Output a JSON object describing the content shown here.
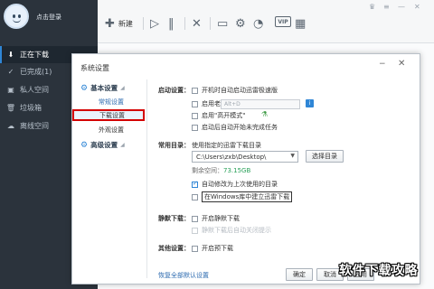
{
  "sidebar": {
    "login_text": "点击登录",
    "items": [
      {
        "label": "正在下载",
        "icon": "download-icon",
        "glyph": "⬇"
      },
      {
        "label": "已完成(1)",
        "icon": "check-circle-icon",
        "glyph": "✓"
      },
      {
        "label": "私人空间",
        "icon": "private-space-icon",
        "glyph": "▣"
      },
      {
        "label": "垃圾箱",
        "icon": "trash-icon",
        "glyph": "🗑"
      },
      {
        "label": "离线空间",
        "icon": "cloud-icon",
        "glyph": "☁"
      }
    ]
  },
  "toolbar": {
    "new_label": "新建",
    "vip_label": "VIP"
  },
  "dialog": {
    "title": "系统设置",
    "tree": {
      "basic_settings": "基本设置",
      "general_settings": "常规设置",
      "download_settings": "下载设置",
      "appearance_settings": "外观设置",
      "advanced_settings": "高级设置"
    },
    "startup": {
      "label": "启动设置：",
      "autostart": "开机时自动启动迅雷极速版",
      "boss_key": "启用老板键",
      "hotkey_placeholder": "Alt+D",
      "high_speed_mode": "启用\"高开模式\"",
      "auto_resume": "启动后自动开始未完成任务"
    },
    "common_dir": {
      "label": "常用目录：",
      "description": "使用指定的迅雷下载目录",
      "path": "C:\\Users\\zxb\\Desktop\\",
      "select_button": "选择目录",
      "free_space_label": "剩余空间：",
      "free_space_value": "73.15GB",
      "auto_change_last": "自动修改为上次使用的目录",
      "create_xunlei_folder": "在Windows库中建立迅雷下载"
    },
    "silent": {
      "label": "静默下载：",
      "enable": "开启静默下载",
      "hidden_option": "静默下载后自动关闭提示"
    },
    "other": {
      "label": "其他设置：",
      "pre_download": "开启预下载"
    },
    "restore_defaults": "恢复全部默认设置",
    "ok_button": "确定",
    "cancel_button": "取消",
    "apply_button": "应用"
  },
  "watermark": "软件下载攻略",
  "checks": {
    "autostart": false,
    "boss_key": false,
    "high_speed_mode": false,
    "auto_resume": false,
    "auto_change_last": true,
    "create_xunlei_folder": false,
    "silent_enable": false,
    "pre_download": false
  }
}
